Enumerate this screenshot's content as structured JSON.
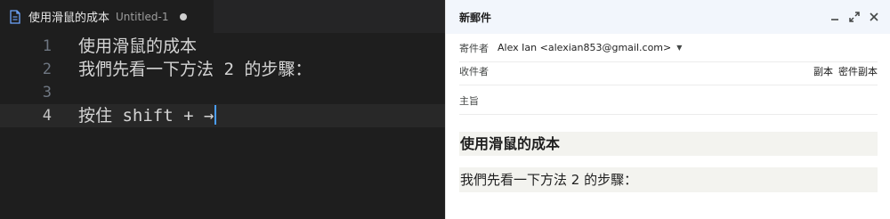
{
  "editor": {
    "tab": {
      "filename": "使用滑鼠的成本",
      "untitled": "Untitled-1",
      "dirty_icon": "dot-icon",
      "file_icon": "file-icon"
    },
    "lines": [
      {
        "number": "1",
        "text": "使用滑鼠的成本"
      },
      {
        "number": "2",
        "text": "我們先看一下方法 2 的步驟："
      },
      {
        "number": "3",
        "text": ""
      },
      {
        "number": "4",
        "text": "按住 shift + →"
      }
    ],
    "current_line": 4,
    "colors": {
      "background": "#1e1e1e",
      "cursor": "#4a9eff"
    }
  },
  "compose": {
    "title": "新郵件",
    "controls": [
      "minimize-icon",
      "expand-icon",
      "close-icon"
    ],
    "from_label": "寄件者",
    "from_value": "Alex Ian <alexian853@gmail.com>",
    "to_label": "收件者",
    "cc_label": "副本",
    "bcc_label": "密件副本",
    "subject_placeholder": "主旨",
    "body": {
      "paragraph1": "使用滑鼠的成本",
      "paragraph2": "我們先看一下方法 2 的步驟："
    },
    "colors": {
      "header_bg": "#f2f6fc",
      "highlight_bg": "#f3f3ef"
    }
  }
}
